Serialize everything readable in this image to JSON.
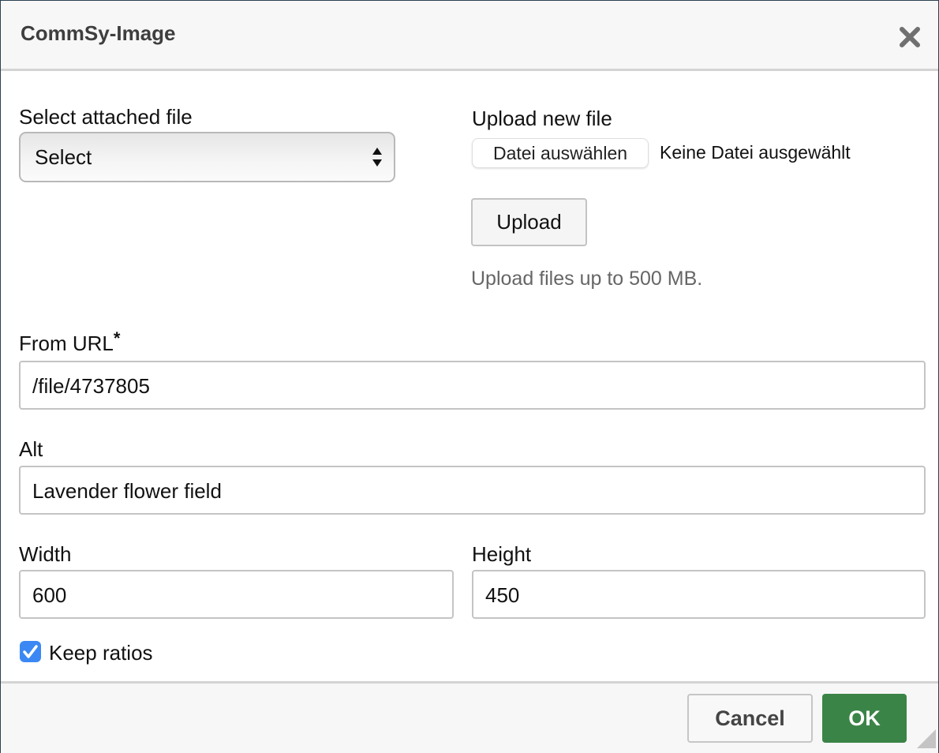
{
  "dialog": {
    "title": "CommSy-Image",
    "close_icon": "close-icon"
  },
  "attached": {
    "label": "Select attached file",
    "select_value": "Select"
  },
  "upload": {
    "label": "Upload new file",
    "choose_button": "Datei auswählen",
    "file_status": "Keine Datei ausgewählt",
    "upload_button": "Upload",
    "hint": "Upload files up to 500 MB."
  },
  "url": {
    "label": "From URL",
    "required_mark": "*",
    "value": "/file/4737805"
  },
  "alt": {
    "label": "Alt",
    "value": "Lavender flower field"
  },
  "width": {
    "label": "Width",
    "value": "600"
  },
  "height": {
    "label": "Height",
    "value": "450"
  },
  "keep_ratios": {
    "label": "Keep ratios",
    "checked": true
  },
  "footer": {
    "cancel": "Cancel",
    "ok": "OK"
  },
  "colors": {
    "ok_button": "#3b8447",
    "checkbox": "#3b88f4"
  }
}
